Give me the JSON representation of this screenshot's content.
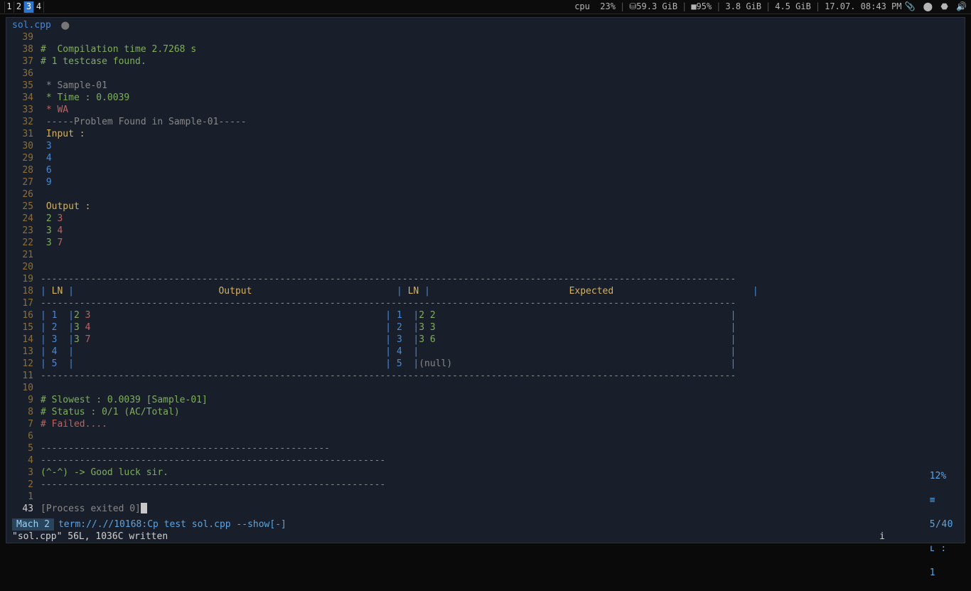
{
  "topbar": {
    "workspaces": [
      "1",
      "2",
      "3",
      "4"
    ],
    "active_workspace_index": 2,
    "cpu_label": "cpu  23%",
    "disk_label": "59.3 GiB",
    "battery_label": "95%",
    "ram1": "3.8 GiB",
    "ram2": "4.5 GiB",
    "clock": "17.07. 08:43 PM"
  },
  "tab": {
    "filename": "sol.cpp",
    "dirty_mark": "⬤"
  },
  "editor_lines": [
    {
      "ln": "39",
      "segs": []
    },
    {
      "ln": "38",
      "segs": [
        {
          "t": "#  Compilation time 2.7268 s",
          "c": "c-green"
        }
      ]
    },
    {
      "ln": "37",
      "segs": [
        {
          "t": "# 1 testcase found.",
          "c": "c-green"
        }
      ]
    },
    {
      "ln": "36",
      "segs": []
    },
    {
      "ln": "35",
      "segs": [
        {
          "t": " * Sample-01",
          "c": "c-grey"
        }
      ]
    },
    {
      "ln": "34",
      "segs": [
        {
          "t": " * Time : 0.0039",
          "c": "c-green"
        }
      ]
    },
    {
      "ln": "33",
      "segs": [
        {
          "t": " * WA",
          "c": "c-red"
        }
      ]
    },
    {
      "ln": "32",
      "segs": [
        {
          "t": " -----Problem Found in Sample-01-----",
          "c": "c-grey"
        }
      ]
    },
    {
      "ln": "31",
      "segs": [
        {
          "t": " Input :",
          "c": "c-ln"
        }
      ]
    },
    {
      "ln": "30",
      "segs": [
        {
          "t": " ",
          "c": ""
        },
        {
          "t": "3",
          "c": "c-blue"
        }
      ]
    },
    {
      "ln": "29",
      "segs": [
        {
          "t": " ",
          "c": ""
        },
        {
          "t": "4",
          "c": "c-blue"
        }
      ]
    },
    {
      "ln": "28",
      "segs": [
        {
          "t": " ",
          "c": ""
        },
        {
          "t": "6",
          "c": "c-blue"
        }
      ]
    },
    {
      "ln": "27",
      "segs": [
        {
          "t": " ",
          "c": ""
        },
        {
          "t": "9",
          "c": "c-blue"
        }
      ]
    },
    {
      "ln": "26",
      "segs": []
    },
    {
      "ln": "25",
      "segs": [
        {
          "t": " Output :",
          "c": "c-ln"
        }
      ]
    },
    {
      "ln": "24",
      "segs": [
        {
          "t": " ",
          "c": ""
        },
        {
          "t": "2",
          "c": "c-green"
        },
        {
          "t": " ",
          "c": ""
        },
        {
          "t": "3",
          "c": "c-red"
        }
      ]
    },
    {
      "ln": "23",
      "segs": [
        {
          "t": " ",
          "c": ""
        },
        {
          "t": "3",
          "c": "c-green"
        },
        {
          "t": " ",
          "c": ""
        },
        {
          "t": "4",
          "c": "c-red"
        }
      ]
    },
    {
      "ln": "22",
      "segs": [
        {
          "t": " ",
          "c": ""
        },
        {
          "t": "3",
          "c": "c-green"
        },
        {
          "t": " ",
          "c": ""
        },
        {
          "t": "7",
          "c": "c-red"
        }
      ]
    },
    {
      "ln": "21",
      "segs": []
    },
    {
      "ln": "20",
      "segs": []
    },
    {
      "ln": "19",
      "segs": [
        {
          "t": "-----------------------------------------------------------------------------------------------------------------------------",
          "c": "c-dash"
        }
      ]
    },
    {
      "ln": "18",
      "segs": [
        {
          "t": "| ",
          "c": "c-pipe"
        },
        {
          "t": "LN",
          "c": "c-ln"
        },
        {
          "t": " |",
          "c": "c-pipe"
        },
        {
          "t": "                          ",
          "c": ""
        },
        {
          "t": "Output",
          "c": "c-ln"
        },
        {
          "t": "                          ",
          "c": ""
        },
        {
          "t": "| ",
          "c": "c-pipe"
        },
        {
          "t": "LN",
          "c": "c-ln"
        },
        {
          "t": " |",
          "c": "c-pipe"
        },
        {
          "t": "                         ",
          "c": ""
        },
        {
          "t": "Expected",
          "c": "c-ln"
        },
        {
          "t": "                         ",
          "c": ""
        },
        {
          "t": "|",
          "c": "c-pipe"
        }
      ]
    },
    {
      "ln": "17",
      "segs": [
        {
          "t": "-----------------------------------------------------------------------------------------------------------------------------",
          "c": "c-dash"
        }
      ]
    },
    {
      "ln": "16",
      "segs": [
        {
          "t": "| ",
          "c": "c-pipe"
        },
        {
          "t": "1",
          "c": "c-blue"
        },
        {
          "t": "  |",
          "c": "c-pipe"
        },
        {
          "t": "2",
          "c": "c-green"
        },
        {
          "t": " ",
          "c": ""
        },
        {
          "t": "3",
          "c": "c-red"
        },
        {
          "t": "                                                     ",
          "c": ""
        },
        {
          "t": "| ",
          "c": "c-pipe"
        },
        {
          "t": "1",
          "c": "c-blue"
        },
        {
          "t": "  |",
          "c": "c-pipe"
        },
        {
          "t": "2",
          "c": "c-green"
        },
        {
          "t": " ",
          "c": ""
        },
        {
          "t": "2",
          "c": "c-green"
        },
        {
          "t": "                                                     ",
          "c": ""
        },
        {
          "t": "|",
          "c": "c-pipe"
        }
      ]
    },
    {
      "ln": "15",
      "segs": [
        {
          "t": "| ",
          "c": "c-pipe"
        },
        {
          "t": "2",
          "c": "c-blue"
        },
        {
          "t": "  |",
          "c": "c-pipe"
        },
        {
          "t": "3",
          "c": "c-green"
        },
        {
          "t": " ",
          "c": ""
        },
        {
          "t": "4",
          "c": "c-red"
        },
        {
          "t": "                                                     ",
          "c": ""
        },
        {
          "t": "| ",
          "c": "c-pipe"
        },
        {
          "t": "2",
          "c": "c-blue"
        },
        {
          "t": "  |",
          "c": "c-pipe"
        },
        {
          "t": "3",
          "c": "c-green"
        },
        {
          "t": " ",
          "c": ""
        },
        {
          "t": "3",
          "c": "c-green"
        },
        {
          "t": "                                                     ",
          "c": ""
        },
        {
          "t": "|",
          "c": "c-pipe"
        }
      ]
    },
    {
      "ln": "14",
      "segs": [
        {
          "t": "| ",
          "c": "c-pipe"
        },
        {
          "t": "3",
          "c": "c-blue"
        },
        {
          "t": "  |",
          "c": "c-pipe"
        },
        {
          "t": "3",
          "c": "c-green"
        },
        {
          "t": " ",
          "c": ""
        },
        {
          "t": "7",
          "c": "c-red"
        },
        {
          "t": "                                                     ",
          "c": ""
        },
        {
          "t": "| ",
          "c": "c-pipe"
        },
        {
          "t": "3",
          "c": "c-blue"
        },
        {
          "t": "  |",
          "c": "c-pipe"
        },
        {
          "t": "3",
          "c": "c-green"
        },
        {
          "t": " ",
          "c": ""
        },
        {
          "t": "6",
          "c": "c-green"
        },
        {
          "t": "                                                     ",
          "c": ""
        },
        {
          "t": "|",
          "c": "c-pipe"
        }
      ]
    },
    {
      "ln": "13",
      "segs": [
        {
          "t": "| ",
          "c": "c-pipe"
        },
        {
          "t": "4",
          "c": "c-blue"
        },
        {
          "t": "  |",
          "c": "c-pipe"
        },
        {
          "t": "                                                        ",
          "c": ""
        },
        {
          "t": "| ",
          "c": "c-pipe"
        },
        {
          "t": "4",
          "c": "c-blue"
        },
        {
          "t": "  |",
          "c": "c-pipe"
        },
        {
          "t": "                                                        ",
          "c": ""
        },
        {
          "t": "|",
          "c": "c-pipe"
        }
      ]
    },
    {
      "ln": "12",
      "segs": [
        {
          "t": "| ",
          "c": "c-pipe"
        },
        {
          "t": "5",
          "c": "c-blue"
        },
        {
          "t": "  |",
          "c": "c-pipe"
        },
        {
          "t": "                                                        ",
          "c": ""
        },
        {
          "t": "| ",
          "c": "c-pipe"
        },
        {
          "t": "5",
          "c": "c-blue"
        },
        {
          "t": "  |",
          "c": "c-pipe"
        },
        {
          "t": "(null)",
          "c": "c-grey"
        },
        {
          "t": "                                                  ",
          "c": ""
        },
        {
          "t": "|",
          "c": "c-pipe"
        }
      ]
    },
    {
      "ln": "11",
      "segs": [
        {
          "t": "-----------------------------------------------------------------------------------------------------------------------------",
          "c": "c-dash"
        }
      ]
    },
    {
      "ln": "10",
      "segs": []
    },
    {
      "ln": "9",
      "segs": [
        {
          "t": "# Slowest : 0.0039 [Sample-01]",
          "c": "c-green"
        }
      ]
    },
    {
      "ln": "8",
      "segs": [
        {
          "t": "# Status : 0/1 (AC/Total)",
          "c": "c-green"
        }
      ]
    },
    {
      "ln": "7",
      "segs": [
        {
          "t": "# Failed....",
          "c": "c-red"
        }
      ]
    },
    {
      "ln": "6",
      "segs": []
    },
    {
      "ln": "5",
      "segs": [
        {
          "t": "----------------------------------------------------",
          "c": "c-dash"
        }
      ]
    },
    {
      "ln": "4",
      "segs": [
        {
          "t": "--------------------------------------------------------------",
          "c": "c-dash"
        }
      ]
    },
    {
      "ln": "3",
      "segs": [
        {
          "t": "(^-^) -> Good luck sir.",
          "c": "c-green"
        }
      ]
    },
    {
      "ln": "2",
      "segs": [
        {
          "t": "--------------------------------------------------------------",
          "c": "c-dash"
        }
      ]
    },
    {
      "ln": "1",
      "segs": []
    }
  ],
  "process_line": {
    "ln": "43",
    "text": "[Process exited 0]"
  },
  "status": {
    "mode": "Mach 2",
    "path": "term://.//10168:Cp test sol.cpp --show[-]",
    "percent": "12%",
    "sep_glyph": "≡",
    "row_col_a": "5/40",
    "row_col_glyph": "ʟ :",
    "row_col_b": "1"
  },
  "msgline": {
    "text": "\"sol.cpp\" 56L, 1036C written",
    "right": "i"
  }
}
